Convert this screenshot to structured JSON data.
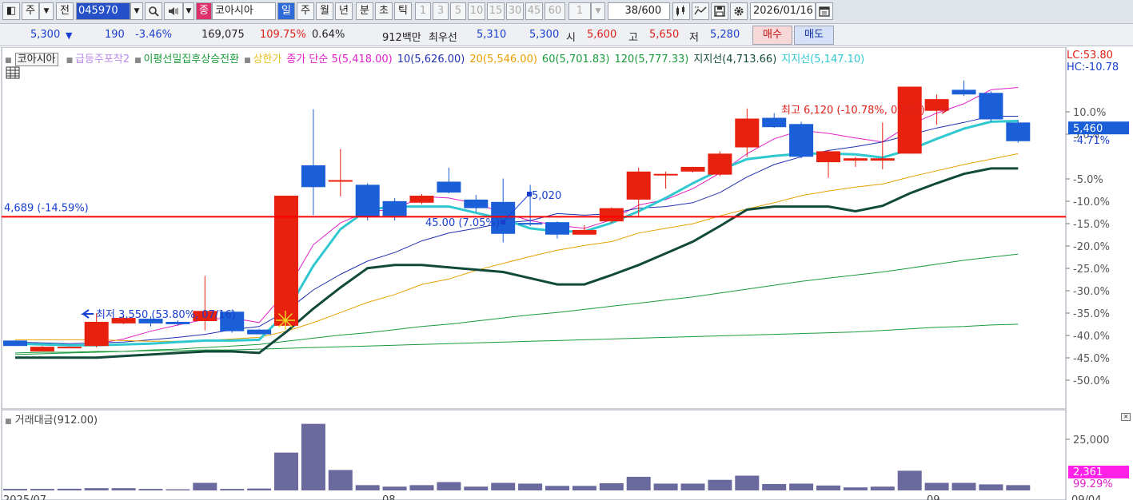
{
  "toolbar": {
    "menu_glyph": "◧",
    "type_label": "주",
    "prev_label": "전",
    "stock_code": "045970",
    "stock_name_badge": "종",
    "stock_name": "코아시아",
    "period_tabs": [
      "일",
      "주",
      "월",
      "년",
      "분",
      "초",
      "틱"
    ],
    "active_period": "일",
    "minute_options": [
      "1",
      "3",
      "5",
      "10",
      "15",
      "30",
      "45",
      "60"
    ],
    "unit_value": "1",
    "count_value": "38",
    "count_max": "/600",
    "date_value": "2026/01/16"
  },
  "quote": {
    "price": "5,300",
    "direction": "▼",
    "change": "190",
    "change_pct": "-3.46%",
    "volume": "169,075",
    "vol_ratio": "109.75%",
    "turnover": "0.64%",
    "amount": "912백만",
    "best_label": "최우선",
    "ask": "5,310",
    "bid": "5,300",
    "open_label": "시",
    "open": "5,600",
    "high_label": "고",
    "high": "5,650",
    "low_label": "저",
    "low": "5,280",
    "buy_label": "매수",
    "sell_label": "매도"
  },
  "legend": {
    "name": "코아시아",
    "items": [
      {
        "text": "급등주포착2",
        "color": "#b98be8"
      },
      {
        "text": "이평선밀집후상승전환",
        "color": "#1a9a3a"
      },
      {
        "text": "상한가",
        "color": "#e8c020"
      },
      {
        "text": "종가 단순 5(5,418.00)",
        "color": "#e020c8"
      },
      {
        "text": "10(5,626.00)",
        "color": "#2030b0"
      },
      {
        "text": "20(5,546.00)",
        "color": "#e8a000"
      },
      {
        "text": "60(5,701.83)",
        "color": "#1a9a3a"
      },
      {
        "text": "120(5,777.33)",
        "color": "#1a9a3a"
      },
      {
        "text": "지지선(4,713.66)",
        "color": "#114a3a"
      },
      {
        "text": "지지선(5,147.10)",
        "color": "#30c8d0"
      }
    ],
    "lc": "LC:53.80",
    "hc": "HC:-10.78"
  },
  "colors": {
    "up": "#e8200e",
    "down": "#1a5ed8",
    "support": "#ff0000"
  },
  "annotations": {
    "support_label": "4,689 (-14.59%)",
    "high_note": "최고 6,120 (-10.78%, 09/02)",
    "low_note": "최저 3,550 (53.80%, 07/16)",
    "mid_note": "45.00 (7.05%)",
    "point_note": "5,020",
    "price_tag": "5,460",
    "price_tag_pct": "-4.71%"
  },
  "volume": {
    "title": "거래대금(912.00)",
    "tag_value": "2,361",
    "tag_pct": "99.29%"
  },
  "chart_data": {
    "type": "candlestick",
    "y_axis_labels": [
      "10.0%",
      "5.0%",
      "-5.0%",
      "-10.0%",
      "-15.0%",
      "-20.0%",
      "-25.0%",
      "-30.0%",
      "-35.0%",
      "-40.0%",
      "-45.0%",
      "-50.0%"
    ],
    "volume_axis_label": "25,000",
    "x_labels": [
      "2025/07",
      "08",
      "09",
      "09/04"
    ],
    "candles": [
      {
        "o": 3.94,
        "c": 3.87,
        "h": 3.94,
        "l": 3.87
      },
      {
        "o": 3.8,
        "c": 3.86,
        "h": 3.87,
        "l": 3.8
      },
      {
        "o": 3.86,
        "c": 3.86,
        "h": 3.86,
        "l": 3.86
      },
      {
        "o": 3.87,
        "c": 4.18,
        "h": 4.29,
        "l": 3.85
      },
      {
        "o": 4.16,
        "c": 4.23,
        "h": 4.26,
        "l": 4.15
      },
      {
        "o": 4.22,
        "c": 4.16,
        "h": 4.25,
        "l": 4.12
      },
      {
        "o": 4.18,
        "c": 4.15,
        "h": 4.2,
        "l": 4.13
      },
      {
        "o": 4.19,
        "c": 4.32,
        "h": 4.77,
        "l": 4.07
      },
      {
        "o": 4.31,
        "c": 4.06,
        "h": 4.34,
        "l": 4.04
      },
      {
        "o": 4.08,
        "c": 4.02,
        "h": 4.09,
        "l": 4.02
      },
      {
        "o": 4.13,
        "c": 5.8,
        "h": 5.8,
        "l": 4.13
      },
      {
        "o": 6.19,
        "c": 5.91,
        "h": 6.91,
        "l": 5.55
      },
      {
        "o": 6.0,
        "c": 6.0,
        "h": 6.4,
        "l": 5.79
      },
      {
        "o": 5.94,
        "c": 5.53,
        "h": 5.96,
        "l": 5.48
      },
      {
        "o": 5.73,
        "c": 5.54,
        "h": 5.77,
        "l": 5.48
      },
      {
        "o": 5.71,
        "c": 5.8,
        "h": 5.82,
        "l": 5.69
      },
      {
        "o": 5.98,
        "c": 5.84,
        "h": 6.16,
        "l": 5.83
      },
      {
        "o": 5.75,
        "c": 5.64,
        "h": 5.81,
        "l": 5.59
      },
      {
        "o": 5.72,
        "c": 5.31,
        "h": 6.02,
        "l": 5.2
      },
      {
        "o": 5.45,
        "c": 5.43,
        "h": 5.94,
        "l": 5.41
      },
      {
        "o": 5.46,
        "c": 5.3,
        "h": 5.47,
        "l": 5.25
      },
      {
        "o": 5.3,
        "c": 5.36,
        "h": 5.42,
        "l": 5.3
      },
      {
        "o": 5.47,
        "c": 5.64,
        "h": 5.65,
        "l": 5.45
      },
      {
        "o": 5.75,
        "c": 6.11,
        "h": 6.16,
        "l": 5.54
      },
      {
        "o": 6.08,
        "c": 6.08,
        "h": 6.11,
        "l": 5.89
      },
      {
        "o": 6.11,
        "c": 6.17,
        "h": 6.17,
        "l": 6.1
      },
      {
        "o": 6.07,
        "c": 6.34,
        "h": 6.37,
        "l": 6.05
      },
      {
        "o": 6.42,
        "c": 6.79,
        "h": 6.92,
        "l": 6.3
      },
      {
        "o": 6.8,
        "c": 6.68,
        "h": 6.86,
        "l": 6.67
      },
      {
        "o": 6.72,
        "c": 6.3,
        "h": 6.75,
        "l": 6.28
      },
      {
        "o": 6.23,
        "c": 6.37,
        "h": 6.39,
        "l": 6.03
      },
      {
        "o": 6.25,
        "c": 6.28,
        "h": 6.3,
        "l": 6.17
      },
      {
        "o": 6.25,
        "c": 6.28,
        "h": 6.74,
        "l": 6.14
      },
      {
        "o": 6.34,
        "c": 7.2,
        "h": 7.2,
        "l": 6.34
      },
      {
        "o": 6.89,
        "c": 7.04,
        "h": 7.1,
        "l": 6.71
      },
      {
        "o": 7.16,
        "c": 7.1,
        "h": 7.28,
        "l": 7.08
      },
      {
        "o": 7.12,
        "c": 6.78,
        "h": 7.14,
        "l": 6.75
      },
      {
        "o": 6.74,
        "c": 6.5,
        "h": 6.77,
        "l": 6.48
      }
    ],
    "volume": [
      2.0,
      2.0,
      2.2,
      3.0,
      3.0,
      2.0,
      1.5,
      10.0,
      2.0,
      2.5,
      50.0,
      88.0,
      27.0,
      7.0,
      5.0,
      7.0,
      11.0,
      5.0,
      10.0,
      9.0,
      6.0,
      6.0,
      9.5,
      18.0,
      9.0,
      9.0,
      14.0,
      19.5,
      8.5,
      9.0,
      6.5,
      4.0,
      5.0,
      26.0,
      10.0,
      10.0,
      8.0,
      7.0
    ],
    "series": [
      {
        "name": "5",
        "color": "#e020c8",
        "width": 1,
        "values": [
          3.92,
          3.89,
          3.87,
          3.9,
          3.96,
          4.06,
          4.14,
          4.21,
          4.23,
          4.17,
          4.57,
          5.17,
          5.45,
          5.6,
          5.62,
          5.79,
          5.77,
          5.7,
          5.58,
          5.48,
          5.42,
          5.38,
          5.49,
          5.68,
          5.75,
          5.89,
          6.09,
          6.34,
          6.53,
          6.64,
          6.6,
          6.54,
          6.49,
          6.71,
          6.86,
          6.98,
          7.16,
          7.19
        ]
      },
      {
        "name": "10",
        "color": "#2030b0",
        "width": 1,
        "values": [
          3.92,
          3.91,
          3.9,
          3.91,
          3.92,
          3.95,
          3.98,
          4.02,
          4.08,
          4.12,
          4.32,
          4.59,
          4.79,
          4.96,
          5.07,
          5.22,
          5.32,
          5.38,
          5.45,
          5.48,
          5.57,
          5.55,
          5.57,
          5.64,
          5.66,
          5.71,
          5.84,
          6.04,
          6.2,
          6.3,
          6.38,
          6.43,
          6.49,
          6.58,
          6.67,
          6.74,
          6.82,
          6.82
        ]
      },
      {
        "name": "20",
        "color": "#e8a000",
        "width": 1,
        "values": [
          3.95,
          3.95,
          3.95,
          3.95,
          3.94,
          3.93,
          3.93,
          3.94,
          3.96,
          3.98,
          4.06,
          4.17,
          4.3,
          4.43,
          4.53,
          4.66,
          4.73,
          4.84,
          4.93,
          5.02,
          5.1,
          5.16,
          5.21,
          5.32,
          5.38,
          5.44,
          5.54,
          5.63,
          5.71,
          5.8,
          5.86,
          5.91,
          5.95,
          6.04,
          6.12,
          6.2,
          6.27,
          6.34
        ]
      },
      {
        "name": "60",
        "color": "#1a9a3a",
        "width": 1,
        "values": [
          3.76,
          3.77,
          3.78,
          3.79,
          3.8,
          3.82,
          3.83,
          3.85,
          3.87,
          3.89,
          3.93,
          3.97,
          4.01,
          4.04,
          4.08,
          4.12,
          4.15,
          4.19,
          4.23,
          4.27,
          4.3,
          4.34,
          4.38,
          4.42,
          4.46,
          4.5,
          4.55,
          4.6,
          4.65,
          4.7,
          4.74,
          4.78,
          4.82,
          4.87,
          4.92,
          4.97,
          5.01,
          5.05
        ]
      },
      {
        "name": "120",
        "color": "#1a9a3a",
        "width": 1,
        "values": [
          3.78,
          3.79,
          3.79,
          3.8,
          3.8,
          3.81,
          3.81,
          3.82,
          3.82,
          3.83,
          3.84,
          3.85,
          3.86,
          3.87,
          3.88,
          3.89,
          3.9,
          3.91,
          3.92,
          3.93,
          3.94,
          3.95,
          3.96,
          3.97,
          3.98,
          3.99,
          4.0,
          4.01,
          4.02,
          4.03,
          4.04,
          4.05,
          4.07,
          4.09,
          4.11,
          4.12,
          4.14,
          4.15
        ]
      },
      {
        "name": "지지선(4,713.66)",
        "color": "#114a3a",
        "width": 3,
        "values": [
          3.72,
          3.72,
          3.72,
          3.72,
          3.74,
          3.76,
          3.78,
          3.8,
          3.8,
          3.78,
          4.05,
          4.35,
          4.62,
          4.87,
          4.91,
          4.91,
          4.88,
          4.85,
          4.82,
          4.74,
          4.66,
          4.66,
          4.78,
          4.91,
          5.06,
          5.21,
          5.41,
          5.62,
          5.66,
          5.66,
          5.66,
          5.6,
          5.67,
          5.83,
          5.96,
          6.08,
          6.15,
          6.15
        ]
      },
      {
        "name": "지지선(5,147.10)",
        "color": "#30c8d0",
        "width": 3,
        "values": [
          3.9,
          3.89,
          3.88,
          3.88,
          3.89,
          3.9,
          3.92,
          3.94,
          3.94,
          3.95,
          4.3,
          4.9,
          5.37,
          5.62,
          5.66,
          5.66,
          5.66,
          5.58,
          5.5,
          5.38,
          5.34,
          5.34,
          5.45,
          5.6,
          5.77,
          5.96,
          6.13,
          6.27,
          6.31,
          6.34,
          6.34,
          6.33,
          6.29,
          6.39,
          6.53,
          6.66,
          6.75,
          6.76
        ]
      }
    ],
    "support_value": 5.53,
    "grid": false
  }
}
